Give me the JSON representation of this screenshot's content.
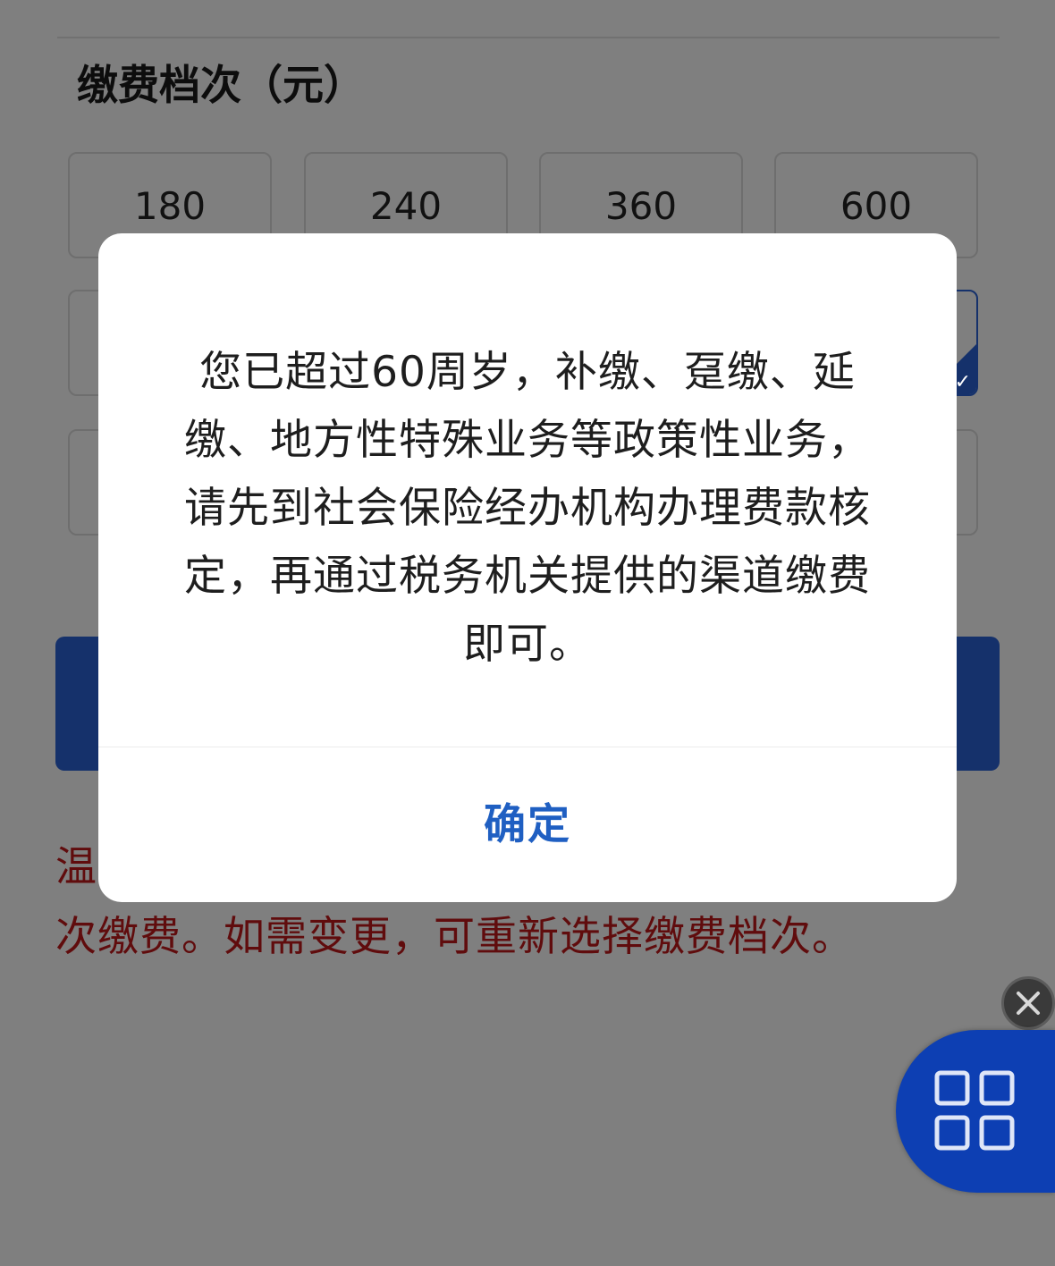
{
  "section_title": "缴费档次（元）",
  "tiers": [
    "180",
    "240",
    "360",
    "600",
    "",
    "",
    "",
    "",
    "",
    "",
    "",
    ""
  ],
  "selected_tier_index": 7,
  "notice_text": "温馨提示：您已选择缴费档次，本年度将按此档次缴费。如需变更，可重新选择缴费档次。",
  "dialog": {
    "message": "您已超过60周岁，补缴、趸缴、延缴、地方性特殊业务等政策性业务，请先到社会保险经办机构办理费款核定，再通过税务机关提供的渠道缴费即可。",
    "confirm_label": "确定"
  },
  "floating": {
    "close_icon": "close-icon",
    "menu_icon": "grid-menu-icon"
  },
  "colors": {
    "accent": "#2a63d6",
    "confirm": "#1f5fc2",
    "notice": "#c0191b",
    "menu_button": "#0d3fb3"
  }
}
